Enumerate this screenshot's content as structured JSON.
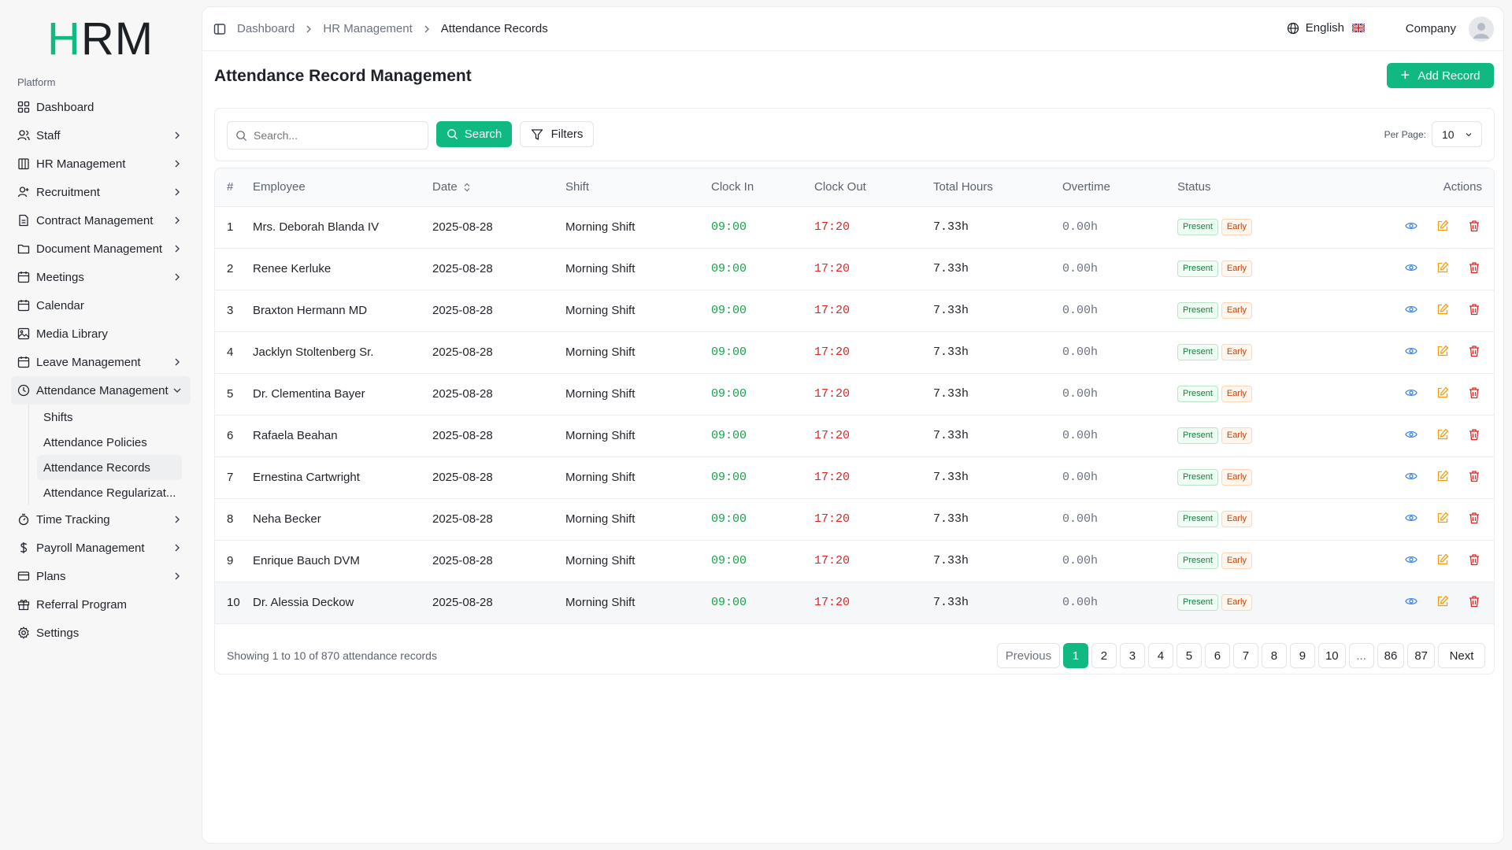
{
  "brand": {
    "logo_first": "H",
    "logo_rest": "RM",
    "accent": "#10b981"
  },
  "sidebar": {
    "section_label": "Platform",
    "items": [
      {
        "label": "Dashboard",
        "icon": "dashboard-icon",
        "has_children": false
      },
      {
        "label": "Staff",
        "icon": "users-icon",
        "has_children": true
      },
      {
        "label": "HR Management",
        "icon": "building-icon",
        "has_children": true
      },
      {
        "label": "Recruitment",
        "icon": "user-plus-icon",
        "has_children": true
      },
      {
        "label": "Contract Management",
        "icon": "file-text-icon",
        "has_children": true
      },
      {
        "label": "Document Management",
        "icon": "folder-icon",
        "has_children": true
      },
      {
        "label": "Meetings",
        "icon": "calendar-icon",
        "has_children": true
      },
      {
        "label": "Calendar",
        "icon": "calendar-icon",
        "has_children": false
      },
      {
        "label": "Media Library",
        "icon": "image-icon",
        "has_children": false
      },
      {
        "label": "Leave Management",
        "icon": "calendar-icon",
        "has_children": true
      },
      {
        "label": "Attendance Management",
        "icon": "clock-icon",
        "has_children": true,
        "expanded": true
      },
      {
        "label": "Time Tracking",
        "icon": "timer-icon",
        "has_children": true
      },
      {
        "label": "Payroll Management",
        "icon": "dollar-icon",
        "has_children": true
      },
      {
        "label": "Plans",
        "icon": "card-icon",
        "has_children": true
      },
      {
        "label": "Referral Program",
        "icon": "gift-icon",
        "has_children": false
      },
      {
        "label": "Settings",
        "icon": "gear-icon",
        "has_children": false
      }
    ],
    "attendance_sub": [
      {
        "label": "Shifts"
      },
      {
        "label": "Attendance Policies"
      },
      {
        "label": "Attendance Records",
        "active": true
      },
      {
        "label": "Attendance Regularizat..."
      }
    ]
  },
  "breadcrumb": [
    "Dashboard",
    "HR Management",
    "Attendance Records"
  ],
  "header": {
    "language": "English",
    "company": "Company"
  },
  "page": {
    "title": "Attendance Record Management",
    "add_label": "Add Record",
    "search_placeholder": "Search...",
    "search_label": "Search",
    "filters_label": "Filters",
    "per_page_label": "Per Page:",
    "per_page_value": "10"
  },
  "table": {
    "columns": [
      "#",
      "Employee",
      "Date",
      "Shift",
      "Clock In",
      "Clock Out",
      "Total Hours",
      "Overtime",
      "Status",
      "Actions"
    ],
    "rows": [
      {
        "n": "1",
        "employee": "Mrs. Deborah Blanda IV",
        "date": "2025-08-28",
        "shift": "Morning Shift",
        "in": "09:00",
        "out": "17:20",
        "total": "7.33h",
        "ot": "0.00h",
        "status": "Present",
        "flag": "Early"
      },
      {
        "n": "2",
        "employee": "Renee Kerluke",
        "date": "2025-08-28",
        "shift": "Morning Shift",
        "in": "09:00",
        "out": "17:20",
        "total": "7.33h",
        "ot": "0.00h",
        "status": "Present",
        "flag": "Early"
      },
      {
        "n": "3",
        "employee": "Braxton Hermann MD",
        "date": "2025-08-28",
        "shift": "Morning Shift",
        "in": "09:00",
        "out": "17:20",
        "total": "7.33h",
        "ot": "0.00h",
        "status": "Present",
        "flag": "Early"
      },
      {
        "n": "4",
        "employee": "Jacklyn Stoltenberg Sr.",
        "date": "2025-08-28",
        "shift": "Morning Shift",
        "in": "09:00",
        "out": "17:20",
        "total": "7.33h",
        "ot": "0.00h",
        "status": "Present",
        "flag": "Early"
      },
      {
        "n": "5",
        "employee": "Dr. Clementina Bayer",
        "date": "2025-08-28",
        "shift": "Morning Shift",
        "in": "09:00",
        "out": "17:20",
        "total": "7.33h",
        "ot": "0.00h",
        "status": "Present",
        "flag": "Early"
      },
      {
        "n": "6",
        "employee": "Rafaela Beahan",
        "date": "2025-08-28",
        "shift": "Morning Shift",
        "in": "09:00",
        "out": "17:20",
        "total": "7.33h",
        "ot": "0.00h",
        "status": "Present",
        "flag": "Early"
      },
      {
        "n": "7",
        "employee": "Ernestina Cartwright",
        "date": "2025-08-28",
        "shift": "Morning Shift",
        "in": "09:00",
        "out": "17:20",
        "total": "7.33h",
        "ot": "0.00h",
        "status": "Present",
        "flag": "Early"
      },
      {
        "n": "8",
        "employee": "Neha Becker",
        "date": "2025-08-28",
        "shift": "Morning Shift",
        "in": "09:00",
        "out": "17:20",
        "total": "7.33h",
        "ot": "0.00h",
        "status": "Present",
        "flag": "Early"
      },
      {
        "n": "9",
        "employee": "Enrique Bauch DVM",
        "date": "2025-08-28",
        "shift": "Morning Shift",
        "in": "09:00",
        "out": "17:20",
        "total": "7.33h",
        "ot": "0.00h",
        "status": "Present",
        "flag": "Early"
      },
      {
        "n": "10",
        "employee": "Dr. Alessia Deckow",
        "date": "2025-08-28",
        "shift": "Morning Shift",
        "in": "09:00",
        "out": "17:20",
        "total": "7.33h",
        "ot": "0.00h",
        "status": "Present",
        "flag": "Early"
      }
    ]
  },
  "pagination": {
    "showing": "Showing 1 to 10 of 870 attendance records",
    "previous": "Previous",
    "next": "Next",
    "pages": [
      "1",
      "2",
      "3",
      "4",
      "5",
      "6",
      "7",
      "8",
      "9",
      "10",
      "...",
      "86",
      "87"
    ],
    "current": "1"
  }
}
